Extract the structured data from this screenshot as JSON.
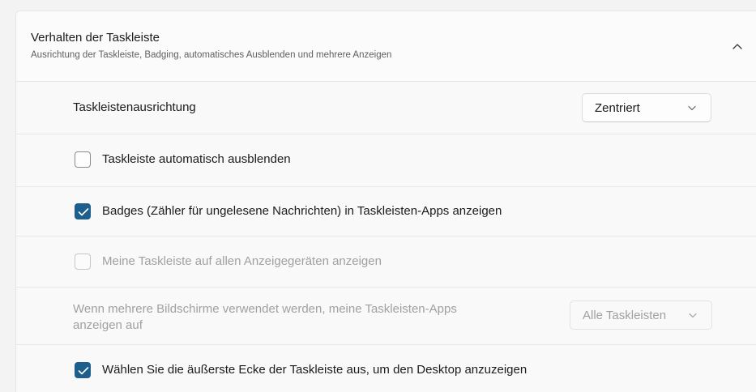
{
  "header": {
    "title": "Verhalten der Taskleiste",
    "subtitle": "Ausrichtung der Taskleiste, Badging, automatisches Ausblenden und mehrere Anzeigen",
    "collapse_icon": "chevron-up-icon"
  },
  "alignment": {
    "label": "Taskleistenausrichtung",
    "value": "Zentriert"
  },
  "autohide": {
    "label": "Taskleiste automatisch ausblenden",
    "checked": false
  },
  "badges": {
    "label": "Badges (Zähler für ungelesene Nachrichten) in Taskleisten-Apps anzeigen",
    "checked": true
  },
  "all_displays": {
    "label": "Meine Taskleiste auf allen Anzeigegeräten anzeigen",
    "checked": false,
    "disabled": true
  },
  "multi_monitor": {
    "label_line1": "Wenn mehrere Bildschirme verwendet werden, meine Taskleisten-Apps",
    "label_line2": "anzeigen auf",
    "value": "Alle Taskleisten",
    "disabled": true
  },
  "desktop_corner": {
    "label": "Wählen Sie die äußerste Ecke der Taskleiste aus, um den Desktop anzuzeigen",
    "checked": true
  },
  "colors": {
    "accent": "#1d5f8c",
    "disabled_text": "#a0a0a0"
  }
}
